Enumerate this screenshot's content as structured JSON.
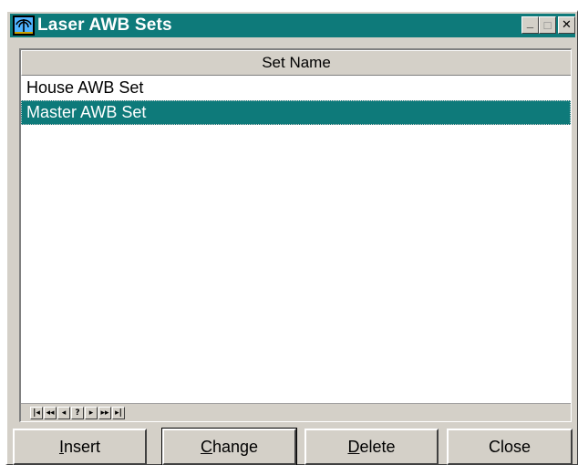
{
  "window": {
    "title": "Laser AWB Sets",
    "minimize_glyph": "_",
    "maximize_glyph": "□",
    "close_glyph": "✕"
  },
  "grid": {
    "column_header": "Set Name",
    "rows": [
      {
        "name": "House AWB Set",
        "selected": false
      },
      {
        "name": "Master AWB Set",
        "selected": true
      }
    ],
    "selection_color": "#0e7a7a"
  },
  "navigator": {
    "buttons": [
      {
        "glyph": "|◂",
        "icon": "first-record-icon"
      },
      {
        "glyph": "◂◂",
        "icon": "prior-page-icon"
      },
      {
        "glyph": "◂",
        "icon": "prior-record-icon"
      },
      {
        "glyph": "?",
        "icon": "search-icon"
      },
      {
        "glyph": "▸",
        "icon": "next-record-icon"
      },
      {
        "glyph": "▸▸",
        "icon": "next-page-icon"
      },
      {
        "glyph": "▸|",
        "icon": "last-record-icon"
      }
    ]
  },
  "buttons": {
    "insert": {
      "mnemonic": "I",
      "rest": "nsert"
    },
    "change": {
      "mnemonic": "C",
      "rest": "hange"
    },
    "delete": {
      "mnemonic": "D",
      "rest": "elete"
    },
    "close": "Close"
  },
  "colors": {
    "titlebar": "#0e7a7a",
    "face": "#d4d0c8"
  }
}
